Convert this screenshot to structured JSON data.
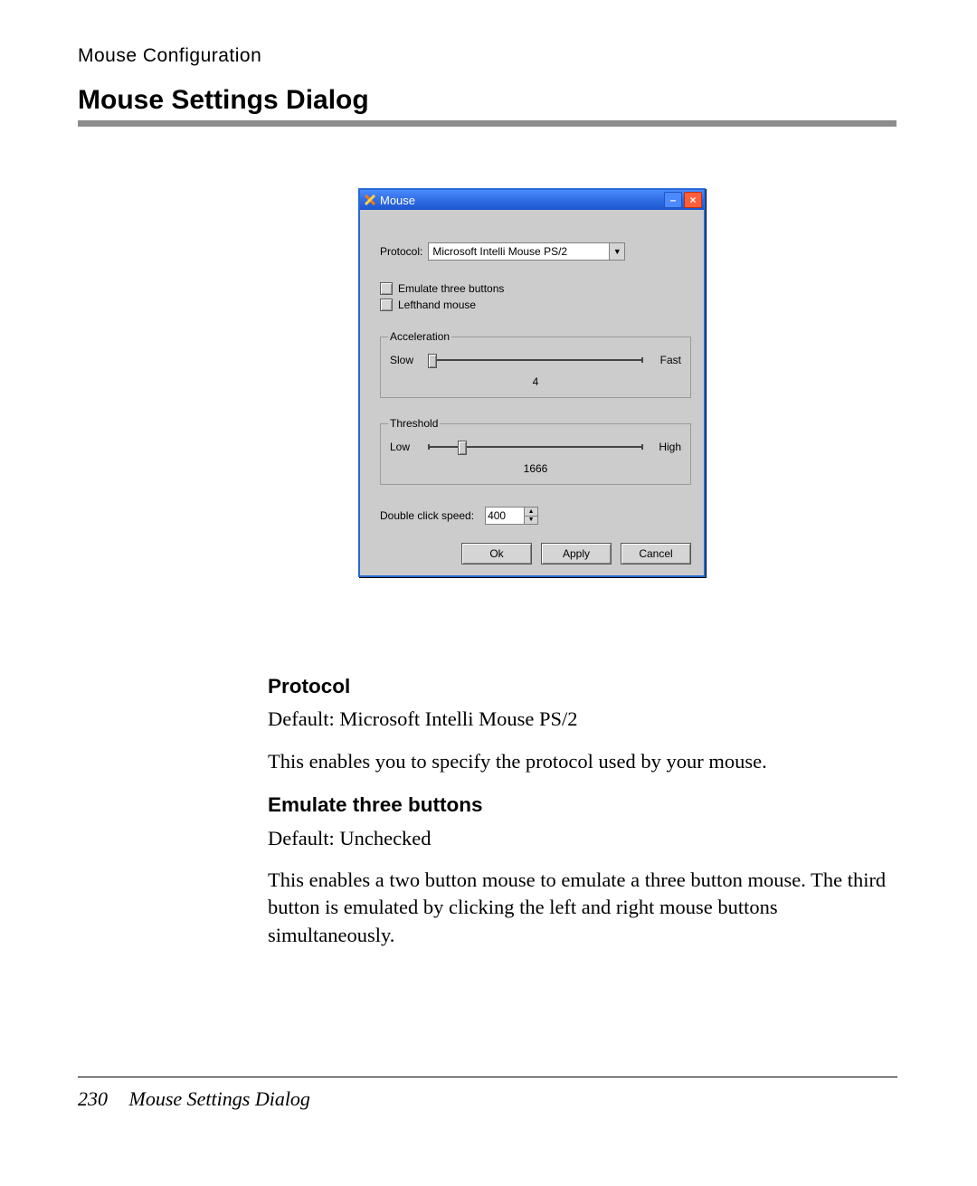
{
  "header": {
    "breadcrumb": "Mouse Configuration",
    "title": "Mouse Settings Dialog"
  },
  "dialog": {
    "window_title": "Mouse",
    "protocol_label": "Protocol:",
    "protocol_value": "Microsoft Intelli Mouse PS/2",
    "emulate_label": "Emulate three buttons",
    "lefthand_label": "Lefthand mouse",
    "accel": {
      "legend": "Acceleration",
      "left": "Slow",
      "right": "Fast",
      "value": "4"
    },
    "thresh": {
      "legend": "Threshold",
      "left": "Low",
      "right": "High",
      "value": "1666"
    },
    "dcs_label": "Double click speed:",
    "dcs_value": "400",
    "buttons": {
      "ok": "Ok",
      "apply": "Apply",
      "cancel": "Cancel"
    }
  },
  "body": {
    "protocol_h": "Protocol",
    "protocol_p1": "Default: Microsoft Intelli Mouse PS/2",
    "protocol_p2": "This enables you to specify the protocol used by your mouse.",
    "emulate_h": "Emulate three buttons",
    "emulate_p1": "Default: Unchecked",
    "emulate_p2": "This enables a two button mouse to emulate a three button mouse. The third button is emulated by clicking the left and right mouse buttons simultaneously."
  },
  "footer": {
    "page_no": "230",
    "title": "Mouse Settings Dialog"
  }
}
